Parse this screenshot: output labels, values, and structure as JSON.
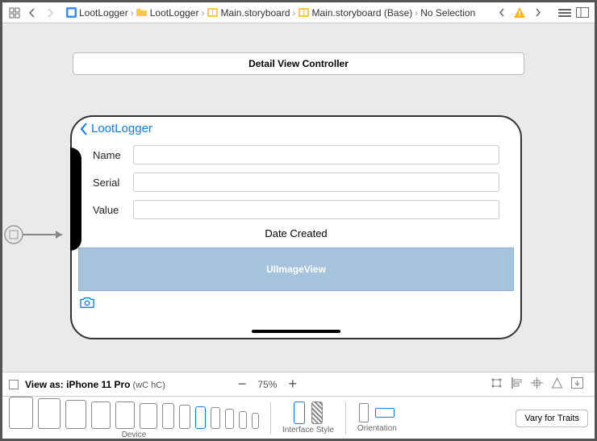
{
  "breadcrumb": {
    "items": [
      {
        "label": "LootLogger"
      },
      {
        "label": "LootLogger"
      },
      {
        "label": "Main.storyboard"
      },
      {
        "label": "Main.storyboard (Base)"
      },
      {
        "label": "No Selection"
      }
    ]
  },
  "scene": {
    "title": "Detail View Controller"
  },
  "nav": {
    "back_label": "LootLogger"
  },
  "form": {
    "name_label": "Name",
    "serial_label": "Serial",
    "value_label": "Value",
    "date_label": "Date Created",
    "image_label": "UIImageView"
  },
  "viewas": {
    "prefix": "View as: ",
    "device": "iPhone 11 Pro",
    "sizeclass": " (wC hC)"
  },
  "zoom": {
    "level": "75%"
  },
  "device_section": {
    "label": "Device"
  },
  "interface_section": {
    "label": "Interface Style"
  },
  "orientation_section": {
    "label": "Orientation"
  },
  "vary_button": "Vary for Traits"
}
